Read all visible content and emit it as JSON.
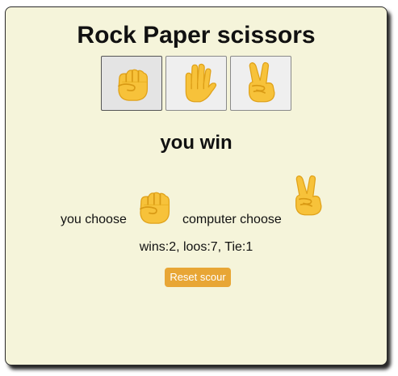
{
  "app": {
    "title": "Rock Paper scissors"
  },
  "choices": [
    {
      "name": "rock",
      "icon": "fist-emoji-icon",
      "selected": true
    },
    {
      "name": "paper",
      "icon": "raised-hand-emoji-icon",
      "selected": false
    },
    {
      "name": "scissors",
      "icon": "victory-hand-emoji-icon",
      "selected": false
    }
  ],
  "result": {
    "text": "you win"
  },
  "moves": {
    "player_label": "you choose",
    "player_icon": "fist-emoji-icon",
    "computer_label": "computer choose",
    "computer_icon": "victory-hand-emoji-icon"
  },
  "score": {
    "text": "wins:2, loos:7, Tie:1"
  },
  "reset": {
    "label": "Reset scour"
  },
  "colors": {
    "card_background": "#f5f4da",
    "reset_button": "#e8a635",
    "emoji_skin": "#f7c23a"
  }
}
